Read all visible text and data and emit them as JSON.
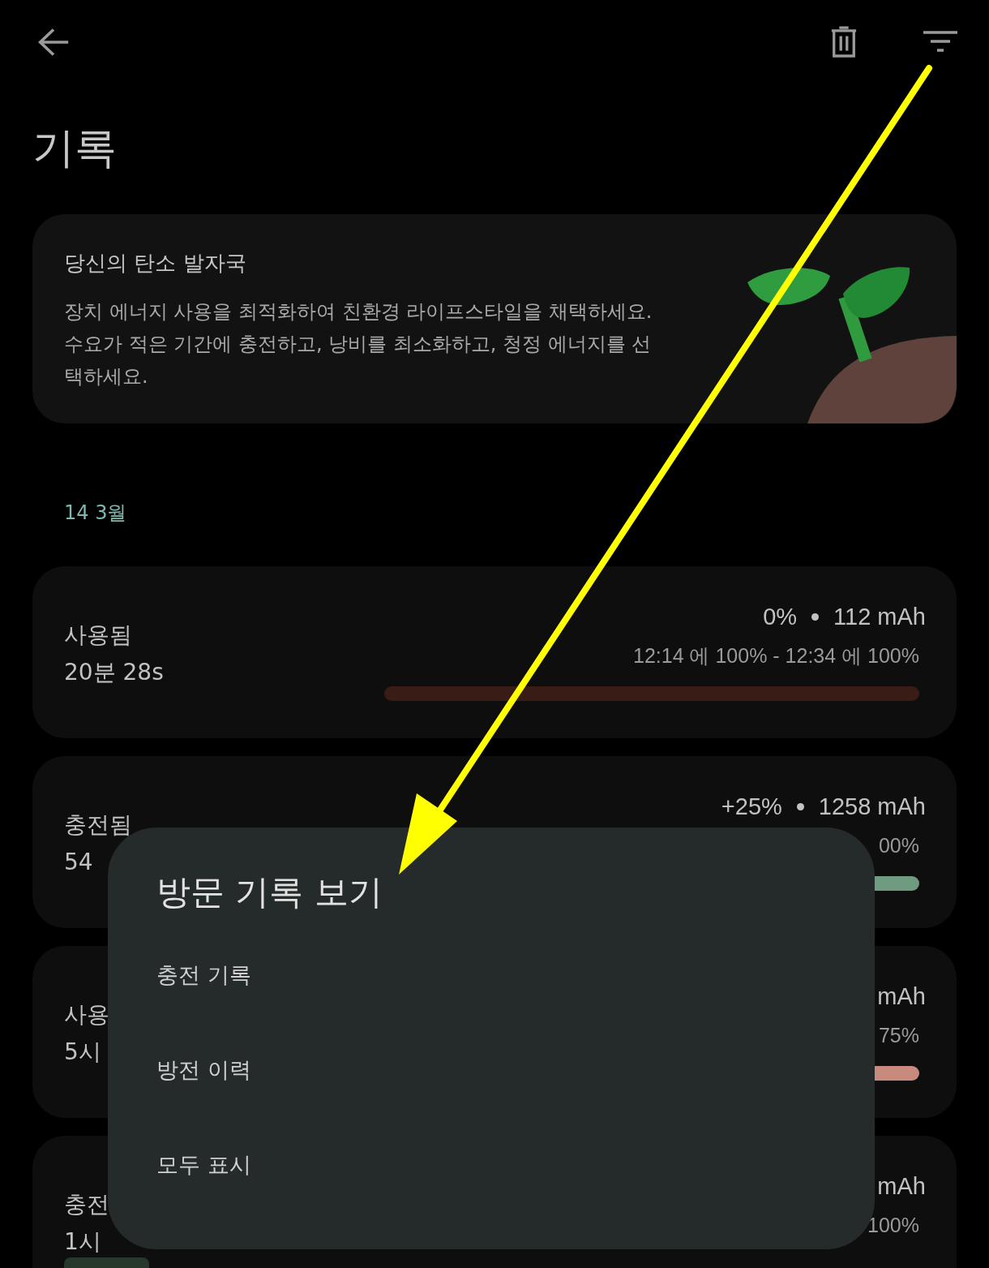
{
  "title": "기록",
  "carbon_card": {
    "title": "당신의 탄소 발자국",
    "body": "장치 에너지 사용을 최적화하여 친환경 라이프스타일을 채택하세요.수요가 적은 기간에 충전하고, 낭비를 최소화하고, 청정 에너지를 선택하세요."
  },
  "date_header": "14 3월",
  "sessions": [
    {
      "label": "사용됨",
      "duration": "20분 28s",
      "amount": "0%",
      "capacity": "112 mAh",
      "range": "12:14 에 100% - 12:34 에 100%",
      "bar": {
        "kind": "track",
        "color": "#3a1c17"
      }
    },
    {
      "label": "충전됨",
      "duration": "54",
      "amount": "+25%",
      "capacity": "1258 mAh",
      "range": "00%",
      "bar": {
        "kind": "track",
        "color": "#6f9c80"
      }
    },
    {
      "label": "사용",
      "duration": "5시",
      "capacity": "mAh",
      "range": "75%",
      "bar": {
        "kind": "track",
        "color": "#c98a7e"
      }
    },
    {
      "label": "충전",
      "duration": "1시",
      "capacity": "mAh",
      "range": "100%",
      "bar": {
        "kind": "strip",
        "color": "#26372b"
      }
    }
  ],
  "dialog": {
    "title": "방문 기록 보기",
    "options": [
      "충전 기록",
      "방전 이력",
      "모두 표시"
    ]
  }
}
